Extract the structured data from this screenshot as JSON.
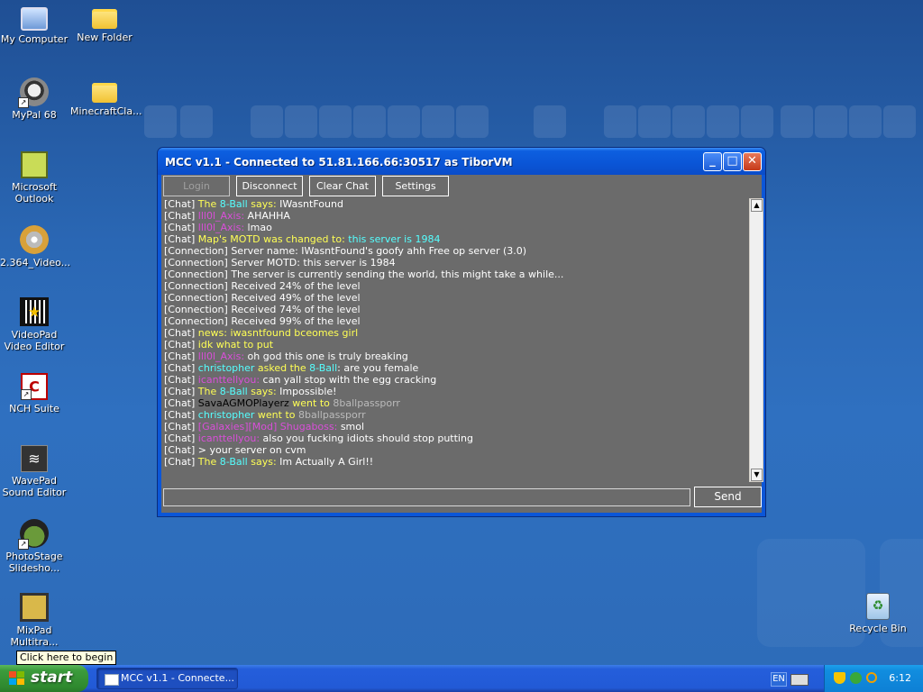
{
  "desktop": {
    "icons": [
      {
        "label": "My Computer"
      },
      {
        "label": "New Folder"
      },
      {
        "label": "MyPal 68"
      },
      {
        "label": "MinecraftCla..."
      },
      {
        "label": "Microsoft Outlook"
      },
      {
        "label": "2.364_Video..."
      },
      {
        "label": "VideoPad Video Editor"
      },
      {
        "label": "NCH Suite"
      },
      {
        "label": "WavePad Sound Editor"
      },
      {
        "label": "PhotoStage Slidesho..."
      },
      {
        "label": "MixPad Multitra..."
      },
      {
        "label": "Recycle Bin"
      }
    ]
  },
  "window": {
    "title": "MCC v1.1 - Connected to 51.81.166.66:30517 as TiborVM",
    "controls": {
      "minimize": "_",
      "maximize": "□",
      "close": "✕"
    },
    "toolbar": {
      "login": "Login",
      "disconnect": "Disconnect",
      "clear_chat": "Clear Chat",
      "settings": "Settings"
    },
    "chat_lines": [
      [
        {
          "t": "[Chat] ",
          "c": "#ffffff"
        },
        {
          "t": "The ",
          "c": "#ffff55"
        },
        {
          "t": "8-Ball",
          "c": "#55ffff"
        },
        {
          "t": " says: ",
          "c": "#ffff55"
        },
        {
          "t": "IWasntFound",
          "c": "#ffffff"
        }
      ],
      [
        {
          "t": "[Chat] ",
          "c": "#ffffff"
        },
        {
          "t": "lll0l_Axis:",
          "c": "#d94fd9"
        },
        {
          "t": " AHAHHA",
          "c": "#ffffff"
        }
      ],
      [
        {
          "t": "[Chat] ",
          "c": "#ffffff"
        },
        {
          "t": "lll0l_Axis:",
          "c": "#d94fd9"
        },
        {
          "t": " lmao",
          "c": "#ffffff"
        }
      ],
      [
        {
          "t": "[Chat] ",
          "c": "#ffffff"
        },
        {
          "t": "Map's MOTD was changed to: ",
          "c": "#ffff55"
        },
        {
          "t": "this server is 1984",
          "c": "#55ffff"
        }
      ],
      [
        {
          "t": "[Connection] Server name: IWasntFound's goofy ahh Free op server (3.0)",
          "c": "#ffffff"
        }
      ],
      [
        {
          "t": "[Connection] Server MOTD: this server is 1984",
          "c": "#ffffff"
        }
      ],
      [
        {
          "t": "[Connection] The server is currently sending the world, this might take a while...",
          "c": "#ffffff"
        }
      ],
      [
        {
          "t": "[Connection] Received 24% of the level",
          "c": "#ffffff"
        }
      ],
      [
        {
          "t": "[Connection] Received 49% of the level",
          "c": "#ffffff"
        }
      ],
      [
        {
          "t": "[Connection] Received 74% of the level",
          "c": "#ffffff"
        }
      ],
      [
        {
          "t": "[Connection] Received 99% of the level",
          "c": "#ffffff"
        }
      ],
      [
        {
          "t": "[Chat] ",
          "c": "#ffffff"
        },
        {
          "t": "news: iwasntfound bceomes girl",
          "c": "#ffff55"
        }
      ],
      [
        {
          "t": "[Chat] ",
          "c": "#ffffff"
        },
        {
          "t": "idk what to put",
          "c": "#ffff55"
        }
      ],
      [
        {
          "t": "[Chat] ",
          "c": "#ffffff"
        },
        {
          "t": "lll0l_Axis:",
          "c": "#d94fd9"
        },
        {
          "t": " oh god this one is truly breaking",
          "c": "#ffffff"
        }
      ],
      [
        {
          "t": "[Chat] ",
          "c": "#ffffff"
        },
        {
          "t": "christopher",
          "c": "#55ffff"
        },
        {
          "t": " asked the ",
          "c": "#ffff55"
        },
        {
          "t": "8-Ball",
          "c": "#55ffff"
        },
        {
          "t": ": are you female",
          "c": "#ffffff"
        }
      ],
      [
        {
          "t": "[Chat] ",
          "c": "#ffffff"
        },
        {
          "t": "icanttellyou:",
          "c": "#d94fd9"
        },
        {
          "t": " can yall stop with the egg cracking",
          "c": "#ffffff"
        }
      ],
      [
        {
          "t": "[Chat] ",
          "c": "#ffffff"
        },
        {
          "t": "The ",
          "c": "#ffff55"
        },
        {
          "t": "8-Ball",
          "c": "#55ffff"
        },
        {
          "t": " says: ",
          "c": "#ffff55"
        },
        {
          "t": "Impossible!",
          "c": "#ffffff"
        }
      ],
      [
        {
          "t": "[Chat] ",
          "c": "#ffffff"
        },
        {
          "t": "SavaAGMOPlayerz",
          "c": "#000000"
        },
        {
          "t": " went to ",
          "c": "#ffff55"
        },
        {
          "t": "8ballpassporr",
          "c": "#bbbbbb"
        }
      ],
      [
        {
          "t": "[Chat] ",
          "c": "#ffffff"
        },
        {
          "t": "christopher",
          "c": "#55ffff"
        },
        {
          "t": " went to ",
          "c": "#ffff55"
        },
        {
          "t": "8ballpassporr",
          "c": "#bbbbbb"
        }
      ],
      [
        {
          "t": "[Chat] ",
          "c": "#ffffff"
        },
        {
          "t": "[Galaxies][Mod] Shugaboss:",
          "c": "#d94fd9"
        },
        {
          "t": " smol",
          "c": "#ffffff"
        }
      ],
      [
        {
          "t": "[Chat] ",
          "c": "#ffffff"
        },
        {
          "t": "icanttellyou:",
          "c": "#d94fd9"
        },
        {
          "t": " also you fucking idiots should stop putting",
          "c": "#ffffff"
        }
      ],
      [
        {
          "t": "[Chat] > your server on cvm",
          "c": "#ffffff"
        }
      ],
      [
        {
          "t": "[Chat] ",
          "c": "#ffffff"
        },
        {
          "t": "The ",
          "c": "#ffff55"
        },
        {
          "t": "8-Ball",
          "c": "#55ffff"
        },
        {
          "t": " says: ",
          "c": "#ffff55"
        },
        {
          "t": "Im Actually A Girl!!",
          "c": "#ffffff"
        }
      ]
    ],
    "input": {
      "value": ""
    },
    "send_label": "Send"
  },
  "taskbar": {
    "start_label": "start",
    "tooltip": "Click here to begin",
    "task_label": "MCC v1.1 - Connecte...",
    "lang": "EN",
    "clock": "6:12"
  }
}
